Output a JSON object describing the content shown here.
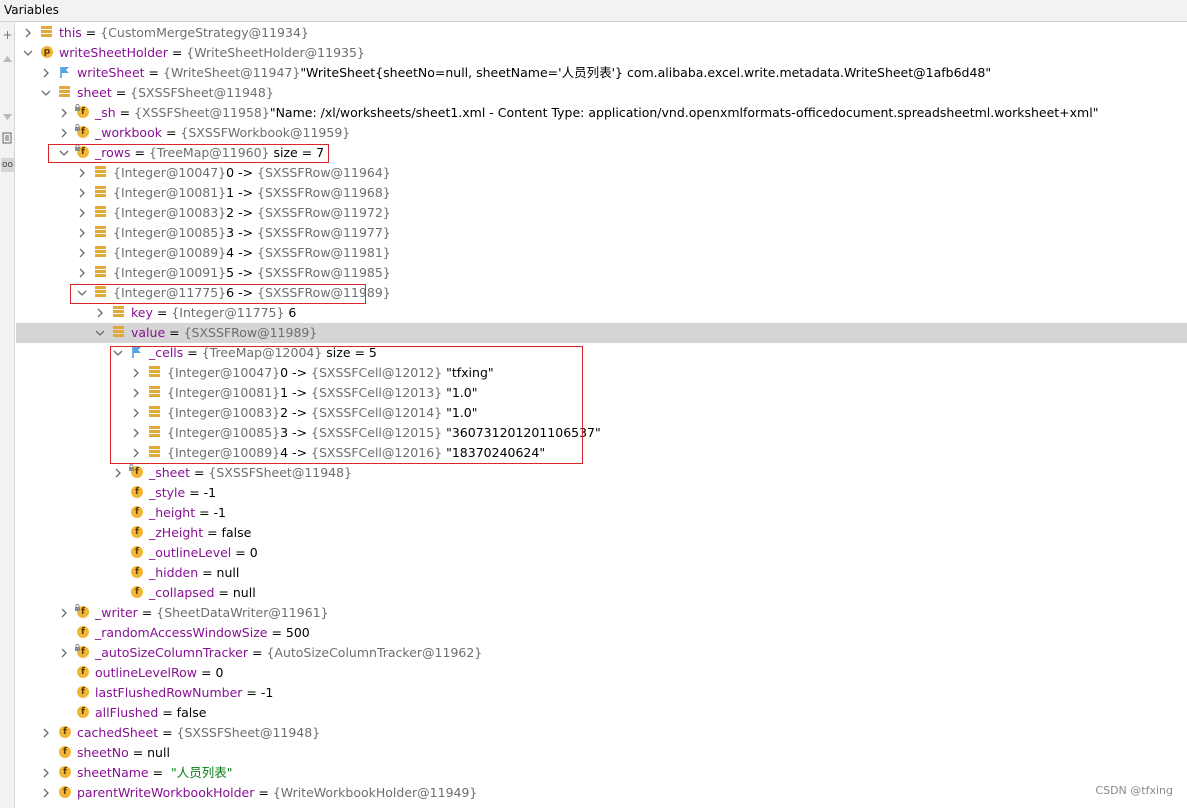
{
  "panel": {
    "title": "Variables"
  },
  "toolbar": {
    "buttons": [
      "+",
      "–",
      "–",
      "≡",
      "oo"
    ]
  },
  "rows": [
    {
      "indent": 0,
      "arrow": "right",
      "icon": "lines",
      "name": "this",
      "ref": "{CustomMergeStrategy@11934}",
      "value": ""
    },
    {
      "indent": 0,
      "arrow": "down",
      "icon": "p",
      "name": "writeSheetHolder",
      "ref": "{WriteSheetHolder@11935}",
      "value": ""
    },
    {
      "indent": 1,
      "arrow": "right",
      "icon": "flag",
      "name": "writeSheet",
      "ref": "{WriteSheet@11947}",
      "value": "\"WriteSheet{sheetNo=null, sheetName='人员列表'} com.alibaba.excel.write.metadata.WriteSheet@1afb6d48\""
    },
    {
      "indent": 1,
      "arrow": "down",
      "icon": "lines",
      "name": "sheet",
      "ref": "{SXSSFSheet@11948}",
      "value": ""
    },
    {
      "indent": 2,
      "arrow": "right",
      "icon": "f-lock",
      "name": "_sh",
      "ref": "{XSSFSheet@11958}",
      "value": "\"Name: /xl/worksheets/sheet1.xml - Content Type: application/vnd.openxmlformats-officedocument.spreadsheetml.worksheet+xml\""
    },
    {
      "indent": 2,
      "arrow": "right",
      "icon": "f-lock",
      "name": "_workbook",
      "ref": "{SXSSFWorkbook@11959}",
      "value": ""
    },
    {
      "indent": 2,
      "arrow": "down",
      "icon": "f-lock",
      "name": "_rows",
      "ref": "{TreeMap@11960}",
      "value": " size = 7"
    },
    {
      "indent": 3,
      "arrow": "right",
      "icon": "lines",
      "name": "",
      "ref": "{Integer@10047}",
      "value": "0 -> ",
      "ref2": "{SXSSFRow@11964}"
    },
    {
      "indent": 3,
      "arrow": "right",
      "icon": "lines",
      "name": "",
      "ref": "{Integer@10081}",
      "value": "1 -> ",
      "ref2": "{SXSSFRow@11968}"
    },
    {
      "indent": 3,
      "arrow": "right",
      "icon": "lines",
      "name": "",
      "ref": "{Integer@10083}",
      "value": "2 -> ",
      "ref2": "{SXSSFRow@11972}"
    },
    {
      "indent": 3,
      "arrow": "right",
      "icon": "lines",
      "name": "",
      "ref": "{Integer@10085}",
      "value": "3 -> ",
      "ref2": "{SXSSFRow@11977}"
    },
    {
      "indent": 3,
      "arrow": "right",
      "icon": "lines",
      "name": "",
      "ref": "{Integer@10089}",
      "value": "4 -> ",
      "ref2": "{SXSSFRow@11981}"
    },
    {
      "indent": 3,
      "arrow": "right",
      "icon": "lines",
      "name": "",
      "ref": "{Integer@10091}",
      "value": "5 -> ",
      "ref2": "{SXSSFRow@11985}"
    },
    {
      "indent": 3,
      "arrow": "down",
      "icon": "lines",
      "name": "",
      "ref": "{Integer@11775}",
      "value": "6 -> ",
      "ref2": "{SXSSFRow@11989}"
    },
    {
      "indent": 4,
      "arrow": "right",
      "icon": "lines",
      "name": "key",
      "ref": "{Integer@11775}",
      "value": " 6"
    },
    {
      "indent": 4,
      "arrow": "down",
      "icon": "lines",
      "name": "value",
      "ref": "{SXSSFRow@11989}",
      "value": "",
      "selected": true
    },
    {
      "indent": 5,
      "arrow": "down",
      "icon": "flag",
      "name": "_cells",
      "ref": "{TreeMap@12004}",
      "value": " size = 5"
    },
    {
      "indent": 6,
      "arrow": "right",
      "icon": "lines",
      "name": "",
      "ref": "{Integer@10047}",
      "value": "0 -> ",
      "ref2": "{SXSSFCell@12012}",
      "str": "\"tfxing\""
    },
    {
      "indent": 6,
      "arrow": "right",
      "icon": "lines",
      "name": "",
      "ref": "{Integer@10081}",
      "value": "1 -> ",
      "ref2": "{SXSSFCell@12013}",
      "str": "\"1.0\""
    },
    {
      "indent": 6,
      "arrow": "right",
      "icon": "lines",
      "name": "",
      "ref": "{Integer@10083}",
      "value": "2 -> ",
      "ref2": "{SXSSFCell@12014}",
      "str": "\"1.0\""
    },
    {
      "indent": 6,
      "arrow": "right",
      "icon": "lines",
      "name": "",
      "ref": "{Integer@10085}",
      "value": "3 -> ",
      "ref2": "{SXSSFCell@12015}",
      "str": "\"360731201201106537\""
    },
    {
      "indent": 6,
      "arrow": "right",
      "icon": "lines",
      "name": "",
      "ref": "{Integer@10089}",
      "value": "4 -> ",
      "ref2": "{SXSSFCell@12016}",
      "str": "\"18370240624\""
    },
    {
      "indent": 5,
      "arrow": "right",
      "icon": "f-lock",
      "name": "_sheet",
      "ref": "{SXSSFSheet@11948}",
      "value": ""
    },
    {
      "indent": 5,
      "arrow": "none",
      "icon": "f",
      "name": "_style",
      "ref": "",
      "value": " = -1"
    },
    {
      "indent": 5,
      "arrow": "none",
      "icon": "f",
      "name": "_height",
      "ref": "",
      "value": " = -1"
    },
    {
      "indent": 5,
      "arrow": "none",
      "icon": "f",
      "name": "_zHeight",
      "ref": "",
      "value": " = false"
    },
    {
      "indent": 5,
      "arrow": "none",
      "icon": "f",
      "name": "_outlineLevel",
      "ref": "",
      "value": " = 0"
    },
    {
      "indent": 5,
      "arrow": "none",
      "icon": "f",
      "name": "_hidden",
      "ref": "",
      "value": " = null"
    },
    {
      "indent": 5,
      "arrow": "none",
      "icon": "f",
      "name": "_collapsed",
      "ref": "",
      "value": " = null"
    },
    {
      "indent": 2,
      "arrow": "right",
      "icon": "f-lock",
      "name": "_writer",
      "ref": "{SheetDataWriter@11961}",
      "value": ""
    },
    {
      "indent": 2,
      "arrow": "none",
      "icon": "f",
      "name": "_randomAccessWindowSize",
      "ref": "",
      "value": " = 500"
    },
    {
      "indent": 2,
      "arrow": "right",
      "icon": "f-lock",
      "name": "_autoSizeColumnTracker",
      "ref": "{AutoSizeColumnTracker@11962}",
      "value": ""
    },
    {
      "indent": 2,
      "arrow": "none",
      "icon": "f",
      "name": "outlineLevelRow",
      "ref": "",
      "value": " = 0"
    },
    {
      "indent": 2,
      "arrow": "none",
      "icon": "f",
      "name": "lastFlushedRowNumber",
      "ref": "",
      "value": " = -1"
    },
    {
      "indent": 2,
      "arrow": "none",
      "icon": "f",
      "name": "allFlushed",
      "ref": "",
      "value": " = false"
    },
    {
      "indent": 1,
      "arrow": "right",
      "icon": "f",
      "name": "cachedSheet",
      "ref": "{SXSSFSheet@11948}",
      "value": ""
    },
    {
      "indent": 1,
      "arrow": "none",
      "icon": "f",
      "name": "sheetNo",
      "ref": "",
      "value": " = null"
    },
    {
      "indent": 1,
      "arrow": "right",
      "icon": "f",
      "name": "sheetName",
      "ref": "",
      "value": " = ",
      "str": "\"人员列表\""
    },
    {
      "indent": 1,
      "arrow": "right",
      "icon": "f",
      "name": "parentWriteWorkbookHolder",
      "ref": "{WriteWorkbookHolder@11949}",
      "value": ""
    }
  ],
  "watermark": "CSDN @tfxing"
}
